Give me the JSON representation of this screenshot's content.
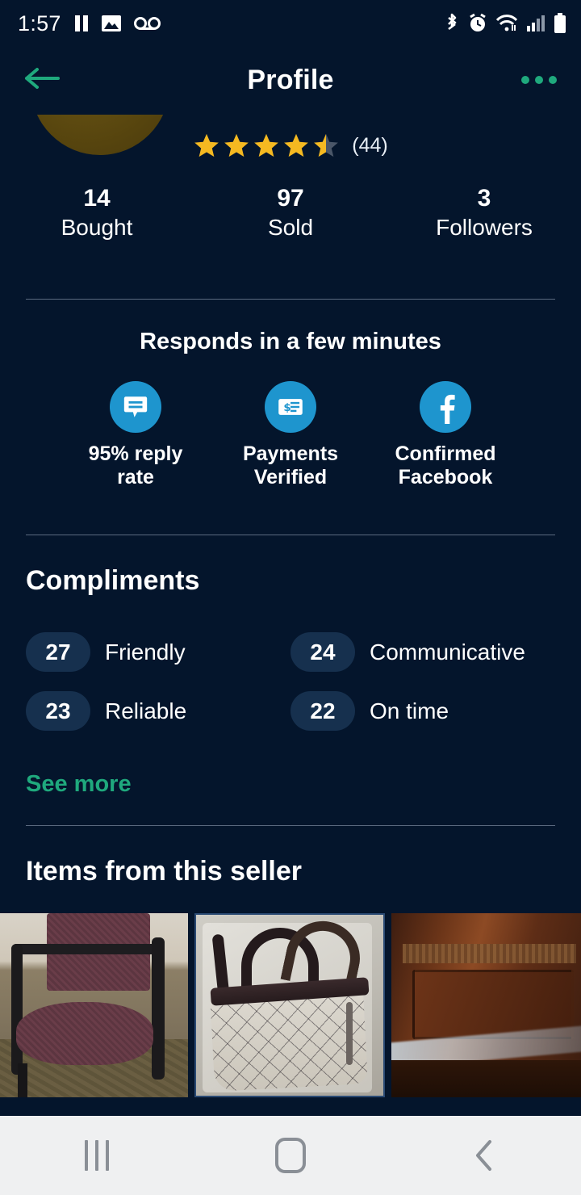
{
  "status_bar": {
    "time": "1:57",
    "left_icons": [
      "pause-icon",
      "image-icon",
      "voicemail-icon"
    ],
    "right_icons": [
      "bluetooth-icon",
      "alarm-icon",
      "wifi-icon",
      "cellular-signal-icon",
      "battery-icon"
    ]
  },
  "app_bar": {
    "title": "Profile",
    "back_icon": "back-arrow-icon",
    "overflow_icon": "more-options-icon"
  },
  "profile": {
    "avatar": "seller-avatar",
    "rating_value": 4.5,
    "rating_stars_full": 4,
    "rating_stars_half": 1,
    "rating_stars_total": 5,
    "review_count_label": "(44)",
    "stats": [
      {
        "number": "14",
        "label": "Bought"
      },
      {
        "number": "97",
        "label": "Sold"
      },
      {
        "number": "3",
        "label": "Followers"
      }
    ]
  },
  "responds": {
    "title": "Responds in a few minutes",
    "badges": [
      {
        "icon": "chat-bubble-icon",
        "label": "95% reply rate"
      },
      {
        "icon": "payment-card-icon",
        "label": "Payments Verified"
      },
      {
        "icon": "facebook-icon",
        "label": "Confirmed Facebook"
      }
    ]
  },
  "compliments": {
    "title": "Compliments",
    "items": [
      {
        "count": "27",
        "label": "Friendly"
      },
      {
        "count": "24",
        "label": "Communicative"
      },
      {
        "count": "23",
        "label": "Reliable"
      },
      {
        "count": "22",
        "label": "On time"
      }
    ],
    "see_more_label": "See more"
  },
  "items_section": {
    "title": "Items from this seller",
    "thumbnails": [
      {
        "alt": "burgundy-upholstered-chair"
      },
      {
        "alt": "monogram-handbag"
      },
      {
        "alt": "dark-wood-furniture"
      }
    ]
  },
  "nav_bar": {
    "recents_icon": "recents-icon",
    "home_icon": "home-icon",
    "back_icon": "nav-back-icon"
  },
  "colors": {
    "background": "#04152c",
    "accent_green": "#1fa97d",
    "badge_blue": "#1e95ce",
    "star_gold": "#f5b921",
    "pill_bg": "#16304e",
    "divider": "#5b6a80",
    "navbar_bg": "#eff0f1"
  }
}
